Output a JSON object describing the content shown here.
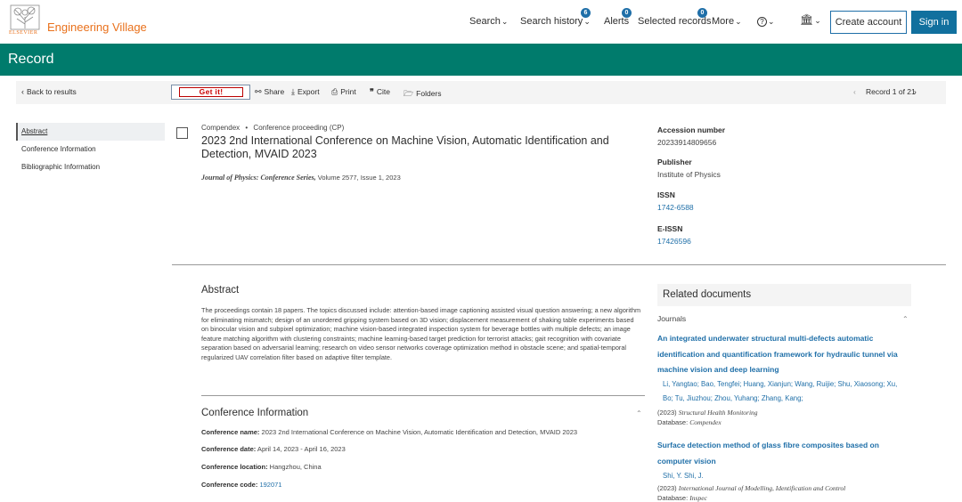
{
  "header": {
    "logo_word": "ELSEVIER",
    "brand": "Engineering Village",
    "nav": {
      "search": "Search",
      "search_history": "Search history",
      "search_history_count": "6",
      "alerts": "Alerts",
      "alerts_count": "0",
      "selected_records": "Selected records",
      "selected_records_count": "0",
      "more": "More"
    },
    "create_account": "Create account",
    "sign_in": "Sign in"
  },
  "banner": {
    "title": "Record"
  },
  "toolbar": {
    "back": "Back to results",
    "get_it": "Get it!",
    "share": "Share",
    "export": "Export",
    "print": "Print",
    "cite": "Cite",
    "folders": "Folders",
    "record_pos": "Record 1 of 21"
  },
  "leftnav": {
    "items": [
      "Abstract",
      "Conference Information",
      "Bibliographic Information"
    ]
  },
  "record": {
    "database": "Compendex",
    "doc_type": "Conference proceeding (CP)",
    "title": "2023 2nd International Conference on Machine Vision, Automatic Identification and Detection, MVAID 2023",
    "journal": "Journal of Physics: Conference Series,",
    "volume_issue": " Volume 2577, Issue 1, 2023",
    "accession_label": "Accession number",
    "accession": "20233914809656",
    "publisher_label": "Publisher",
    "publisher": "Institute of Physics",
    "issn_label": "ISSN",
    "issn": "1742-6588",
    "eissn_label": "E-ISSN",
    "eissn": "17426596"
  },
  "abstract": {
    "heading": "Abstract",
    "text": "The proceedings contain 18 papers. The topics discussed include: attention-based image captioning assisted visual question answering; a new algorithm for eliminating mismatch; design of an unordered gripping system based on 3D vision; displacement measurement of shaking table experiments based on binocular vision and subpixel optimization; machine vision-based integrated inspection system for beverage bottles with multiple defects; an image feature matching algorithm with clustering constraints; machine learning-based target prediction for terrorist attacks; gait recognition with covariate separation based on adversarial learning; research on video sensor networks coverage optimization method in obstacle scene; and spatial-temporal regularized UAV correlation filter based on adaptive filter template."
  },
  "conference": {
    "heading": "Conference Information",
    "name_label": "Conference name:",
    "name": " 2023 2nd International Conference on Machine Vision, Automatic Identification and Detection, MVAID 2023",
    "date_label": "Conference date:",
    "date": " April 14, 2023 - April 16, 2023",
    "location_label": "Conference location:",
    "location": " Hangzhou, China",
    "code_label": "Conference code:",
    "code": "192071"
  },
  "related": {
    "heading": "Related documents",
    "section": "Journals",
    "docs": [
      {
        "title": "An integrated underwater structural multi-defects automatic identification and quantification framework for hydraulic tunnel via machine vision and deep learning",
        "authors": "Li, Yangtao; Bao, Tengfei; Huang, Xianjun; Wang, Ruijie; Shu, Xiaosong; Xu, Bo;  Tu, Jiuzhou; Zhou, Yuhang; Zhang, Kang;",
        "year": "(2023)",
        "journal": "Structural Health Monitoring",
        "db_label": "Database:",
        "db": "Compendex"
      },
      {
        "title": "Surface detection method of glass fibre composites based on computer vision",
        "authors": "Shi, Y.     Shi, J.",
        "year": "(2023)",
        "journal": "International Journal of Modelling, Identification and Control",
        "db_label": "Database:",
        "db": "Inspec"
      }
    ]
  },
  "icons": [
    "elsevier-tree-icon",
    "chevron-down-icon",
    "help-icon",
    "institution-icon",
    "share-icon",
    "export-icon",
    "print-icon",
    "cite-icon",
    "folder-icon",
    "chevron-left-icon",
    "chevron-right-icon",
    "chevron-up-icon"
  ]
}
